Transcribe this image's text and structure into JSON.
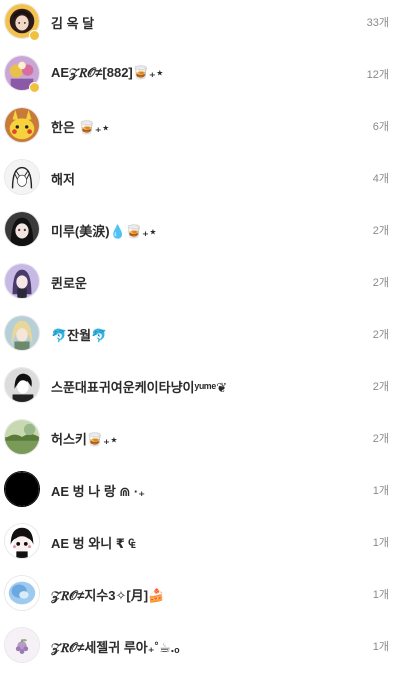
{
  "friends": [
    {
      "name": "김 옥 달",
      "count": "33개",
      "avatar_icon": "dark-haired-portrait-avatar",
      "avatar_color": "#f2c14e",
      "badge": true
    },
    {
      "name": "AE𝒵𝑅𝒪≠[882]🥃₊⋆",
      "count": "12개",
      "avatar_icon": "character-group-avatar",
      "avatar_color": "#c9a6d6",
      "badge": true
    },
    {
      "name": "한은 🥃₊⋆",
      "count": "6개",
      "avatar_icon": "pikachu-avatar",
      "avatar_color": "#f6d33c",
      "badge": false
    },
    {
      "name": "해저",
      "count": "4개",
      "avatar_icon": "manga-sketch-avatar",
      "avatar_color": "#f4f4f4",
      "badge": false
    },
    {
      "name": "미루(美涙)💧🥃₊⋆",
      "count": "2개",
      "avatar_icon": "dark-anime-portrait-avatar",
      "avatar_color": "#3a3a3a",
      "badge": false
    },
    {
      "name": "퀸로운",
      "count": "2개",
      "avatar_icon": "purple-anime-avatar",
      "avatar_color": "#c7b9e6",
      "badge": false
    },
    {
      "name": "🐬잔월🐬",
      "count": "2개",
      "avatar_icon": "blonde-anime-avatar",
      "avatar_color": "#b7cfd6",
      "badge": false
    },
    {
      "name": "스푼대표귀여운케이타냥이ʸᵘᵐᵉ❦",
      "count": "2개",
      "avatar_icon": "black-white-sketch-avatar",
      "avatar_color": "#dcdcdc",
      "badge": false
    },
    {
      "name": "허스키🥃₊⋆",
      "count": "2개",
      "avatar_icon": "green-landscape-avatar",
      "avatar_color": "#7a9a5a",
      "badge": false
    },
    {
      "name": "AE 벙 나 랑 ⋒ ·₊",
      "count": "1개",
      "avatar_icon": "black-circle-avatar",
      "avatar_color": "#000000",
      "badge": false
    },
    {
      "name": "AE 벙 와니 ₹ ₠",
      "count": "1개",
      "avatar_icon": "chibi-character-avatar",
      "avatar_color": "#ffffff",
      "badge": false
    },
    {
      "name": "𝒵𝑅𝒪≠지수3✧[月]🍰",
      "count": "1개",
      "avatar_icon": "blue-watercolor-avatar",
      "avatar_color": "#7fb5e8",
      "badge": false
    },
    {
      "name": "𝒵𝑅𝒪≠세젤귀 루아₊˚☕.ₒ",
      "count": "1개",
      "avatar_icon": "grape-avatar",
      "avatar_color": "#f6f1f6",
      "badge": false
    }
  ]
}
